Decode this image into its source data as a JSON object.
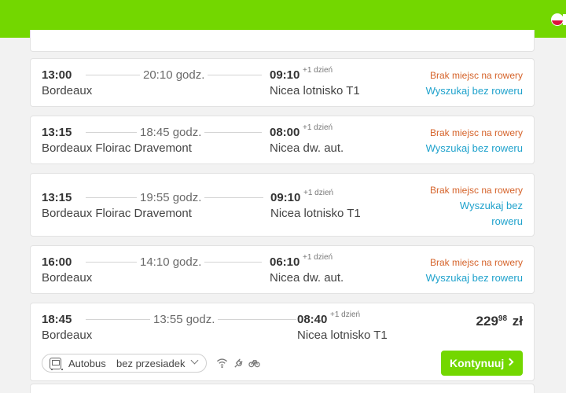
{
  "header": {
    "language_flag_icon": "poland-flag-icon"
  },
  "results": [
    {
      "dep_time": "13:00",
      "dep_city": "Bordeaux",
      "duration": "20:10 godz.",
      "arr_time": "09:10",
      "plus_day": "+1 dzień",
      "arr_city": "Nicea lotnisko T1",
      "warning": "Brak miejsc na rowery",
      "action": "Wyszukaj bez roweru"
    },
    {
      "dep_time": "13:15",
      "dep_city": "Bordeaux Floirac Dravemont",
      "duration": "18:45 godz.",
      "arr_time": "08:00",
      "plus_day": "+1 dzień",
      "arr_city": "Nicea dw. aut.",
      "warning": "Brak miejsc na rowery",
      "action": "Wyszukaj bez roweru"
    },
    {
      "dep_time": "13:15",
      "dep_city": "Bordeaux Floirac Dravemont",
      "duration": "19:55 godz.",
      "arr_time": "09:10",
      "plus_day": "+1 dzień",
      "arr_city": "Nicea lotnisko T1",
      "warning": "Brak miejsc na rowery",
      "action_line1": "Wyszukaj bez",
      "action_line2": "roweru"
    },
    {
      "dep_time": "16:00",
      "dep_city": "Bordeaux",
      "duration": "14:10 godz.",
      "arr_time": "06:10",
      "plus_day": "+1 dzień",
      "arr_city": "Nicea dw. aut.",
      "warning": "Brak miejsc na rowery",
      "action": "Wyszukaj bez roweru"
    },
    {
      "dep_time": "18:45",
      "dep_city": "Bordeaux",
      "duration": "13:55 godz.",
      "arr_time": "08:40",
      "plus_day": "+1 dzień",
      "arr_city": "Nicea lotnisko T1",
      "price_main": "229",
      "price_cents": "98",
      "price_currency": "zł",
      "transport": "Autobus",
      "connection": "bez przesiadek",
      "amenities": [
        "wifi-icon",
        "power-plug-icon",
        "bike-icon"
      ],
      "continue_label": "Kontynuuj"
    }
  ],
  "colors": {
    "brand": "#73d700",
    "warning": "#d5632a",
    "link": "#1fa2cc"
  }
}
